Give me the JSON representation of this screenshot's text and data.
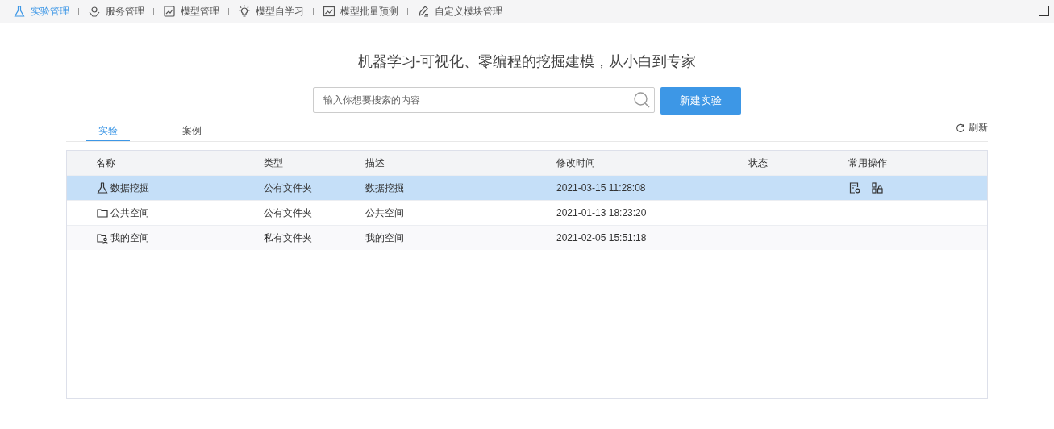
{
  "nav": [
    {
      "label": "实验管理",
      "selected": true
    },
    {
      "label": "服务管理",
      "selected": false
    },
    {
      "label": "模型管理",
      "selected": false
    },
    {
      "label": "模型自学习",
      "selected": false
    },
    {
      "label": "模型批量预测",
      "selected": false
    },
    {
      "label": "自定义模块管理",
      "selected": false
    }
  ],
  "headline": "机器学习-可视化、零编程的挖掘建模，从小白到专家",
  "search": {
    "placeholder": "输入你想要搜索的内容"
  },
  "new_button": "新建实验",
  "tabs": [
    {
      "label": "实验",
      "selected": true
    },
    {
      "label": "案例",
      "selected": false
    }
  ],
  "refresh": "刷新",
  "table": {
    "columns": [
      "名称",
      "类型",
      "描述",
      "修改时间",
      "状态",
      "常用操作"
    ],
    "rows": [
      {
        "kind": "experiment",
        "name": "数据挖掘",
        "type": "公有文件夹",
        "description": "数据挖掘",
        "modified": "2021-03-15 11:28:08",
        "selected": true
      },
      {
        "kind": "folder",
        "name": "公共空间",
        "type": "公有文件夹",
        "description": "公共空间",
        "modified": "2021-01-13 18:23:20",
        "selected": false
      },
      {
        "kind": "private-folder",
        "name": "我的空间",
        "type": "私有文件夹",
        "description": "我的空间",
        "modified": "2021-02-05 15:51:18",
        "selected": false
      }
    ]
  }
}
